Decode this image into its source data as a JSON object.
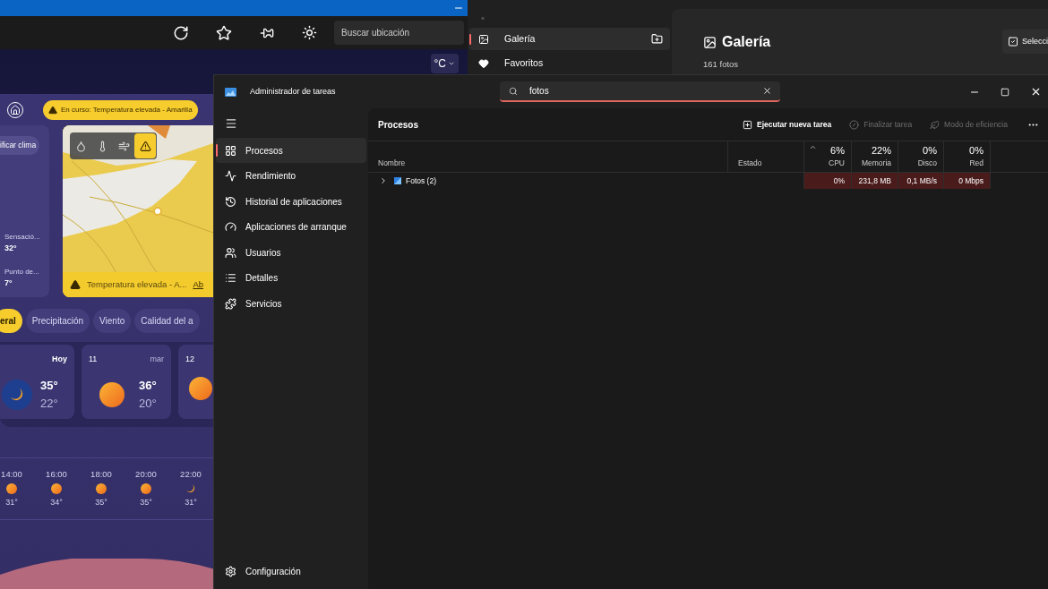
{
  "weather": {
    "search": {
      "placeholder": "Buscar ubicación"
    },
    "unit": "°C",
    "alert": "En curso: Temperatura elevada - Amarilla",
    "summary": {
      "button": "ificar clima",
      "details": [
        {
          "label": "Sensació...",
          "value": "32°"
        },
        {
          "label": "Punto de...",
          "value": "7°"
        }
      ]
    },
    "map": {
      "layers": [
        {
          "selected": false
        },
        {
          "selected": false
        },
        {
          "selected": false
        },
        {
          "selected": true
        }
      ],
      "banner": {
        "text": "Temperatura elevada - A...",
        "link": "Ab"
      }
    },
    "tabs": [
      {
        "label": "eral",
        "selected": true
      },
      {
        "label": "Precipitación",
        "selected": false
      },
      {
        "label": "Viento",
        "selected": false
      },
      {
        "label": "Calidad del a",
        "selected": false
      }
    ],
    "days": [
      {
        "day": "Hoy",
        "kind": "night",
        "high": "35°",
        "low": "22°"
      },
      {
        "date": "11",
        "day": "mar",
        "kind": "sunny",
        "high": "36°",
        "low": "20°"
      },
      {
        "date": "12",
        "kind": "sunny"
      }
    ],
    "hourly": [
      {
        "time": "14:00",
        "kind": "sunny",
        "temp": "31°"
      },
      {
        "time": "16:00",
        "kind": "sunny",
        "temp": "34°"
      },
      {
        "time": "18:00",
        "kind": "sunny",
        "temp": "35°"
      },
      {
        "time": "20:00",
        "kind": "sunny",
        "temp": "35°"
      },
      {
        "time": "22:00",
        "kind": "night",
        "temp": "31°"
      }
    ]
  },
  "photos": {
    "nav": [
      {
        "label": "Galería",
        "selected": true
      },
      {
        "label": "Favoritos",
        "selected": false
      }
    ],
    "title": "Galería",
    "count": "161 fotos",
    "select_button": "Selecci"
  },
  "task_manager": {
    "title": "Administrador de tareas",
    "search": {
      "value": "fotos"
    },
    "nav": [
      {
        "label": "Procesos",
        "selected": true
      },
      {
        "label": "Rendimiento",
        "selected": false
      },
      {
        "label": "Historial de aplicaciones",
        "selected": false
      },
      {
        "label": "Aplicaciones de arranque",
        "selected": false
      },
      {
        "label": "Usuarios",
        "selected": false
      },
      {
        "label": "Detalles",
        "selected": false
      },
      {
        "label": "Servicios",
        "selected": false
      }
    ],
    "settings": "Configuración",
    "heading": "Procesos",
    "actions": [
      {
        "label": "Ejecutar nueva tarea",
        "disabled": false
      },
      {
        "label": "Finalizar tarea",
        "disabled": true
      },
      {
        "label": "Modo de eficiencia",
        "disabled": true
      }
    ],
    "columns": [
      {
        "label": "Nombre",
        "sorted": false
      },
      {
        "label": "Estado",
        "sorted": false
      },
      {
        "label": "CPU",
        "usage": "6%",
        "sorted": true
      },
      {
        "label": "Memoria",
        "usage": "22%",
        "sorted": false
      },
      {
        "label": "Disco",
        "usage": "0%",
        "sorted": false
      },
      {
        "label": "Red",
        "usage": "0%",
        "sorted": false
      }
    ],
    "rows": [
      {
        "expanded": false,
        "cells": [
          "Fotos (2)",
          "",
          "0%",
          "231,8 MB",
          "0,1 MB/s",
          "0 Mbps"
        ]
      }
    ]
  }
}
